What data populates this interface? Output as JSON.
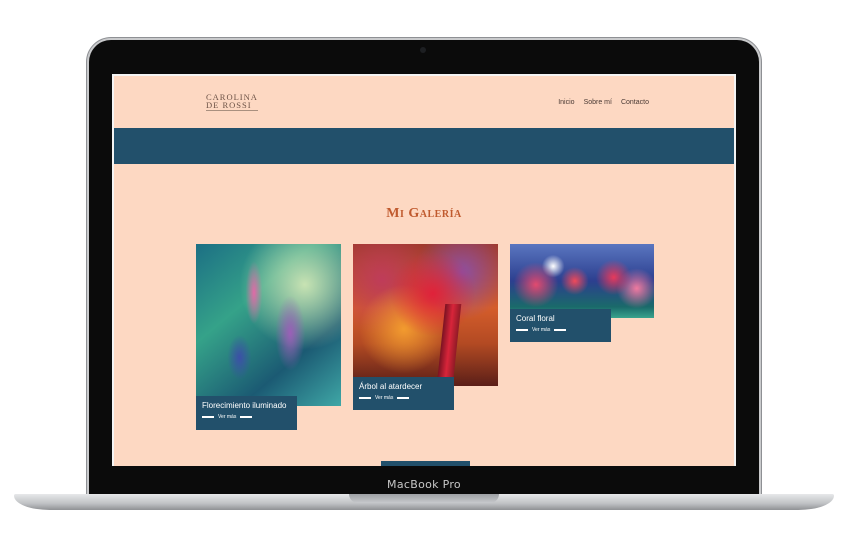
{
  "device": {
    "bezel_label": "MacBook Pro"
  },
  "site": {
    "logo": {
      "line1": "Carolina",
      "line2": "De Rossi"
    },
    "nav": [
      "Inicio",
      "Sobre mí",
      "Contacto"
    ],
    "gallery_title": "Mi Galería",
    "cards": [
      {
        "title": "Florecimiento iluminado",
        "more": "Ver más"
      },
      {
        "title": "Árbol al atardecer",
        "more": "Ver más"
      },
      {
        "title": "Coral floral",
        "more": "Ver más"
      }
    ]
  },
  "colors": {
    "background": "#fdd8c2",
    "accent": "#22506b",
    "title": "#c05a2e"
  }
}
